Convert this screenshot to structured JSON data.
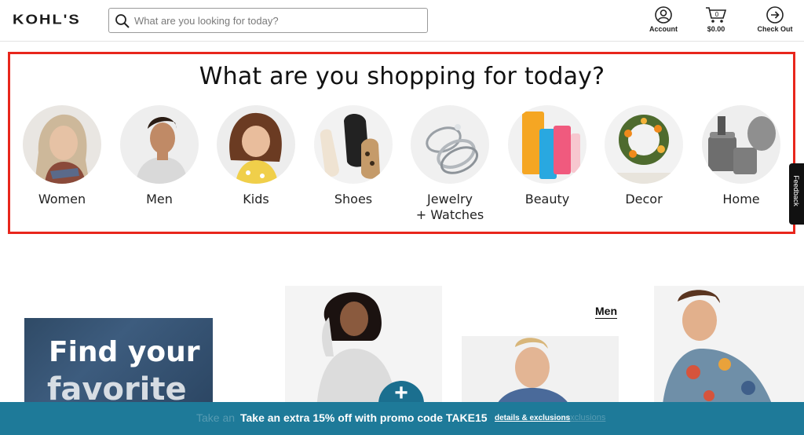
{
  "header": {
    "logo": "KOHL'S",
    "search_placeholder": "What are you looking for today?",
    "account_label": "Account",
    "cart_count": "0",
    "cart_label": "$0.00",
    "checkout_label": "Check Out"
  },
  "categories": {
    "title": "What are you shopping for today?",
    "items": [
      {
        "label": "Women"
      },
      {
        "label": "Men"
      },
      {
        "label": "Kids"
      },
      {
        "label": "Shoes"
      },
      {
        "label": "Jewelry\n+ Watches"
      },
      {
        "label": "Beauty"
      },
      {
        "label": "Decor"
      },
      {
        "label": "Home"
      }
    ]
  },
  "feedback_label": "Feedback",
  "promos": {
    "denim_line1": "Find your",
    "denim_line2": "favorite",
    "men_link": "Men",
    "plus": "+"
  },
  "promo_bar": {
    "ghost_text": "Take an",
    "message": "Take an extra 15% off with promo code TAKE15",
    "link": "details & exclusions",
    "ghost_link": "exclusions"
  },
  "colors": {
    "highlight_border": "#e8261c",
    "promo_bar": "#1e7a99",
    "plus_button": "#1b6f8f"
  }
}
